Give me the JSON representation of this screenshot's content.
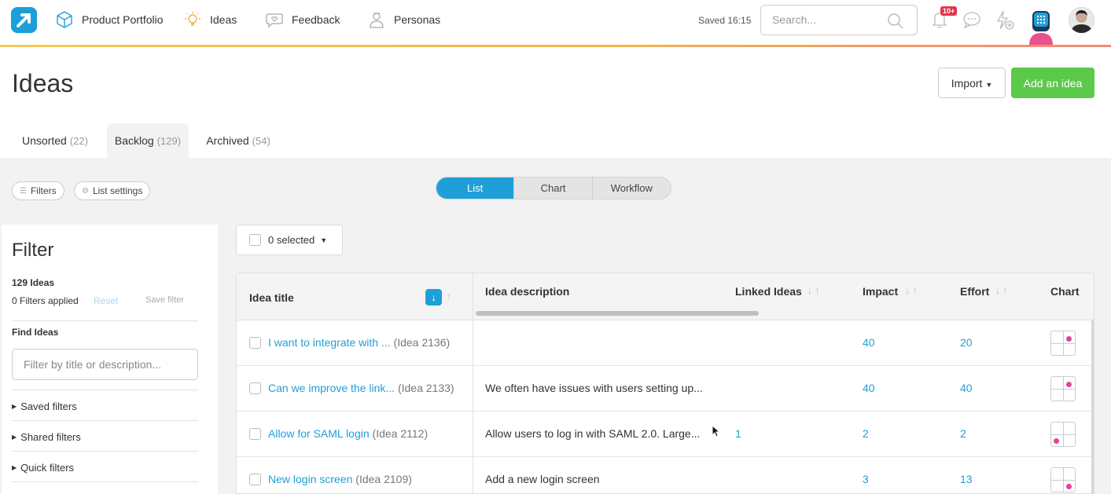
{
  "nav": {
    "items": [
      {
        "label": "Product Portfolio",
        "icon": "cube-icon"
      },
      {
        "label": "Ideas",
        "icon": "lightbulb-icon"
      },
      {
        "label": "Feedback",
        "icon": "heart-chat-icon"
      },
      {
        "label": "Personas",
        "icon": "persona-icon"
      }
    ],
    "saved": "Saved 16:15",
    "search_placeholder": "Search...",
    "notification_badge": "10+"
  },
  "page": {
    "title": "Ideas",
    "import_label": "Import",
    "add_label": "Add an idea"
  },
  "tabs": [
    {
      "label": "Unsorted",
      "count": "(22)"
    },
    {
      "label": "Backlog",
      "count": "(129)"
    },
    {
      "label": "Archived",
      "count": "(54)"
    }
  ],
  "toolbar": {
    "filters_label": "Filters",
    "list_settings_label": "List settings",
    "views": [
      "List",
      "Chart",
      "Workflow"
    ],
    "selected_label": "0 selected"
  },
  "filter": {
    "title": "Filter",
    "count": "129 Ideas",
    "applied": "0 Filters applied",
    "reset": "Reset",
    "save": "Save filter",
    "find_label": "Find Ideas",
    "find_placeholder": "Filter by title or description...",
    "groups": [
      "Saved filters",
      "Shared filters",
      "Quick filters"
    ]
  },
  "table": {
    "headers": {
      "title": "Idea title",
      "description": "Idea description",
      "linked": "Linked Ideas",
      "impact": "Impact",
      "effort": "Effort",
      "chart": "Chart"
    },
    "rows": [
      {
        "title": "I want to integrate with ...",
        "id": "(Idea 2136)",
        "description": "",
        "linked": "",
        "impact": "40",
        "effort": "20",
        "dot": "top-right"
      },
      {
        "title": "Can we improve the link...",
        "id": "(Idea 2133)",
        "description": "We often have issues with users setting up...",
        "linked": "",
        "impact": "40",
        "effort": "40",
        "dot": "top-right"
      },
      {
        "title": "Allow for SAML login",
        "id": "(Idea 2112)",
        "description": "Allow users to log in with SAML 2.0. Large...",
        "linked": "1",
        "impact": "2",
        "effort": "2",
        "dot": "bottom-left"
      },
      {
        "title": "New login screen",
        "id": "(Idea 2109)",
        "description": "Add a new login screen",
        "linked": "",
        "impact": "3",
        "effort": "13",
        "dot": "bottom-right"
      }
    ]
  }
}
